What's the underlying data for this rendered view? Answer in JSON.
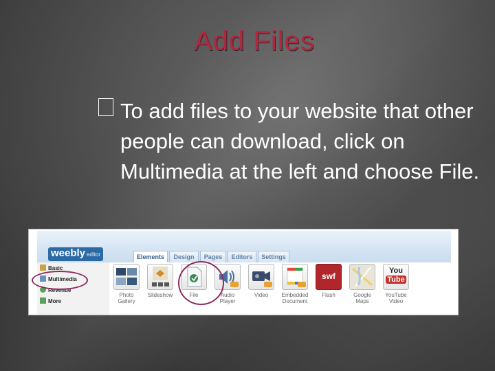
{
  "slide": {
    "title": "Add Files",
    "bullet_text": "To add files to your website that other people can download, click on Multimedia at the left and choose File."
  },
  "editor": {
    "logo": "weebly",
    "logo_sub": "editor",
    "tabs": [
      "Elements",
      "Design",
      "Pages",
      "Editors",
      "Settings"
    ],
    "active_tab": "Elements",
    "sidebar": [
      "Basic",
      "Multimedia",
      "Revenue",
      "More"
    ],
    "elements": [
      {
        "line1": "Photo",
        "line2": "Gallery",
        "icon": "photo-gallery-icon"
      },
      {
        "line1": "Slideshow",
        "line2": "",
        "icon": "slideshow-icon"
      },
      {
        "line1": "File",
        "line2": "",
        "icon": "file-icon"
      },
      {
        "line1": "Audio",
        "line2": "Player",
        "icon": "audio-player-icon"
      },
      {
        "line1": "Video",
        "line2": "",
        "icon": "video-icon"
      },
      {
        "line1": "Embedded",
        "line2": "Document",
        "icon": "embedded-document-icon"
      },
      {
        "line1": "Flash",
        "line2": "",
        "icon": "flash-icon",
        "badge": "swf"
      },
      {
        "line1": "Google",
        "line2": "Maps",
        "icon": "google-maps-icon"
      },
      {
        "line1": "YouTube",
        "line2": "Video",
        "icon": "youtube-icon",
        "badge1": "You",
        "badge2": "Tube"
      }
    ],
    "highlight_color": "#8e2a5c"
  }
}
